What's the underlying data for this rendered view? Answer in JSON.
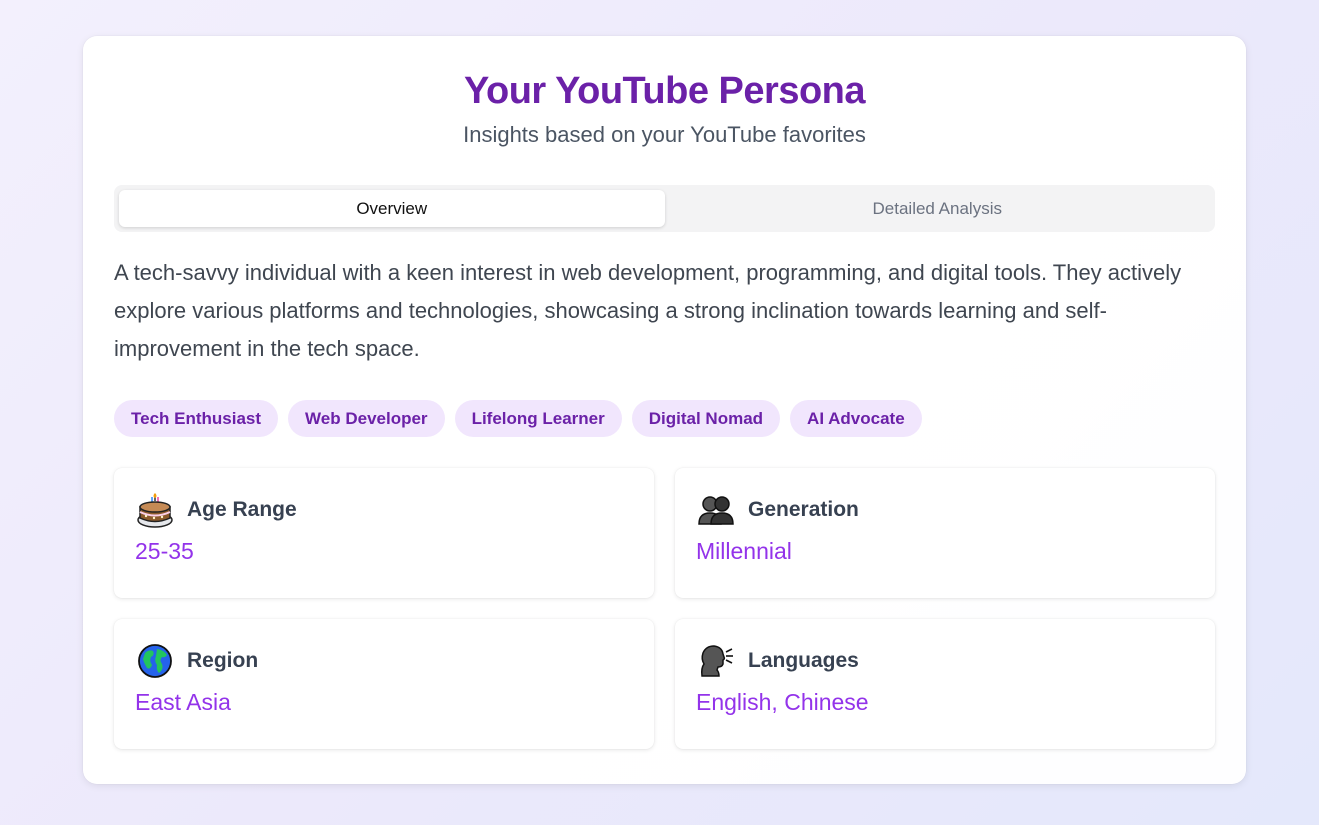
{
  "header": {
    "title": "Your YouTube Persona",
    "subtitle": "Insights based on your YouTube favorites"
  },
  "tabs": [
    {
      "label": "Overview",
      "active": true
    },
    {
      "label": "Detailed Analysis",
      "active": false
    }
  ],
  "overview": {
    "description": "A tech-savvy individual with a keen interest in web development, programming, and digital tools. They actively explore various platforms and technologies, showcasing a strong inclination towards learning and self-improvement in the tech space.",
    "tags": [
      "Tech Enthusiast",
      "Web Developer",
      "Lifelong Learner",
      "Digital Nomad",
      "AI Advocate"
    ],
    "stats": [
      {
        "icon": "birthday-cake-icon",
        "label": "Age Range",
        "value": "25-35"
      },
      {
        "icon": "people-silhouettes-icon",
        "label": "Generation",
        "value": "Millennial"
      },
      {
        "icon": "globe-icon",
        "label": "Region",
        "value": "East Asia"
      },
      {
        "icon": "speaking-head-icon",
        "label": "Languages",
        "value": "English, Chinese"
      }
    ]
  },
  "colors": {
    "accent": "#6b21a8",
    "value": "#9333ea",
    "tag_bg": "#f1e6fd"
  }
}
